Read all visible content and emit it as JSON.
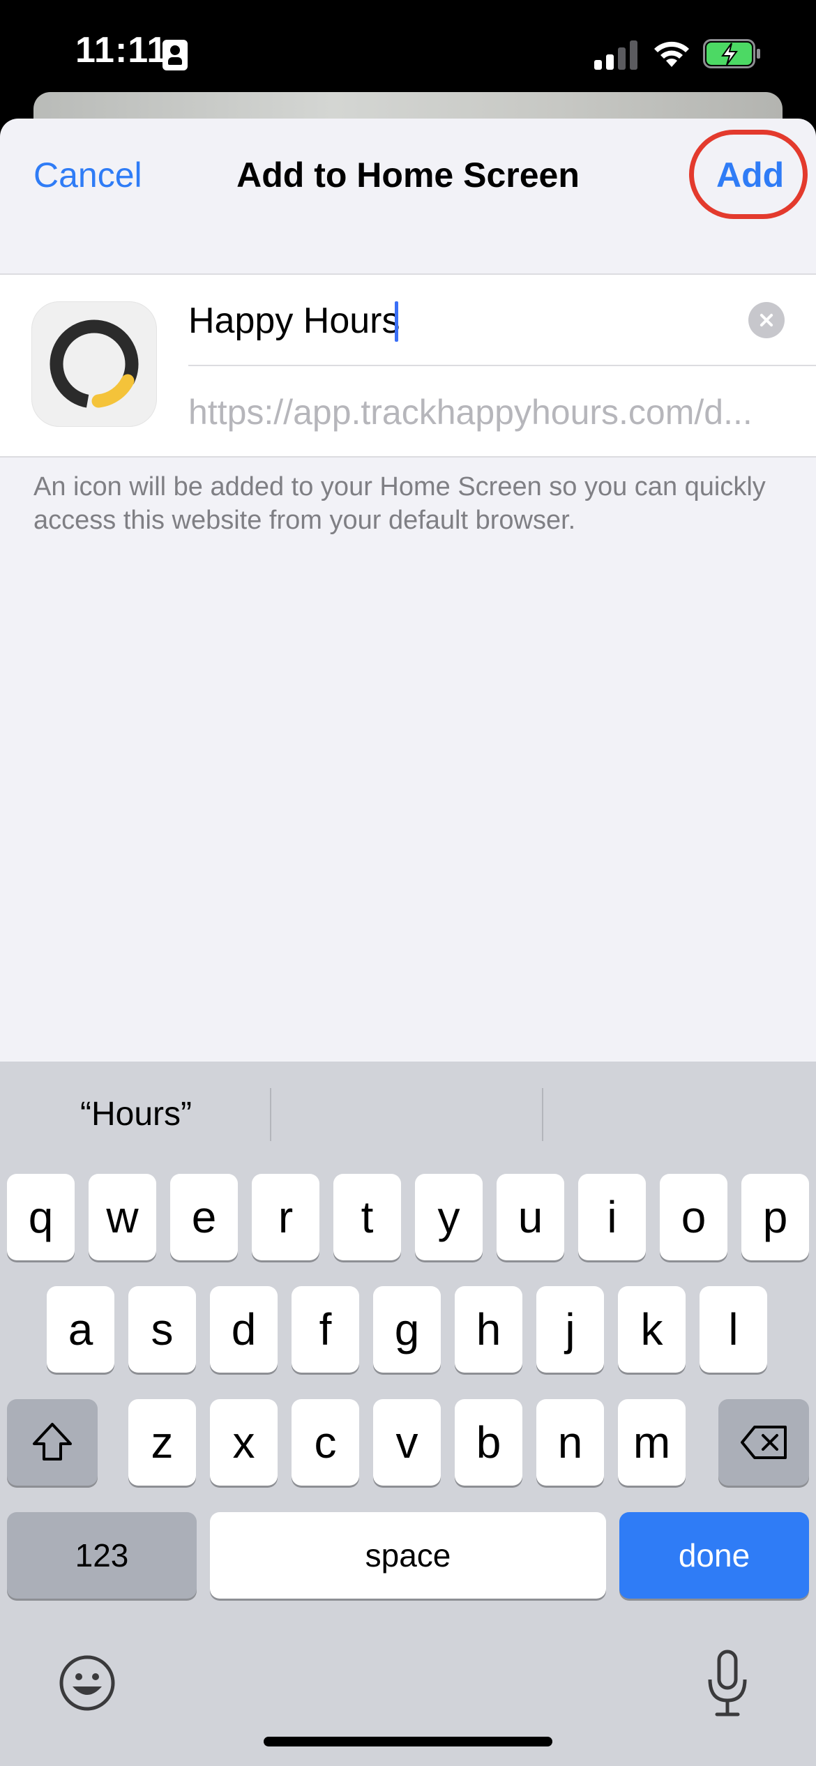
{
  "status_bar": {
    "time": "11:11",
    "icons": [
      "sim-card-icon",
      "cell-signal-icon",
      "wifi-icon",
      "battery-charging-icon"
    ]
  },
  "sheet": {
    "nav": {
      "cancel_label": "Cancel",
      "title": "Add to Home Screen",
      "add_label": "Add"
    },
    "form": {
      "icon": "app-logo-ring-icon",
      "name_value": "Happy Hours",
      "url": "https://app.trackhappyhours.com/d..."
    },
    "footnote": "An icon will be added to your Home Screen so you can quickly access this website from your default browser."
  },
  "keyboard": {
    "suggestions": [
      "“Hours”",
      "",
      ""
    ],
    "row1": [
      "q",
      "w",
      "e",
      "r",
      "t",
      "y",
      "u",
      "i",
      "o",
      "p"
    ],
    "row2": [
      "a",
      "s",
      "d",
      "f",
      "g",
      "h",
      "j",
      "k",
      "l"
    ],
    "row3": [
      "z",
      "x",
      "c",
      "v",
      "b",
      "n",
      "m"
    ],
    "numbers_label": "123",
    "space_label": "space",
    "done_label": "done"
  },
  "colors": {
    "accent": "#2f7cf6",
    "highlight_circle": "#e33a2d",
    "keyboard_bg": "#d1d3d9",
    "sheet_bg": "#f2f2f7",
    "logo_yellow": "#f4c33a",
    "logo_dark": "#2b2b2b"
  }
}
